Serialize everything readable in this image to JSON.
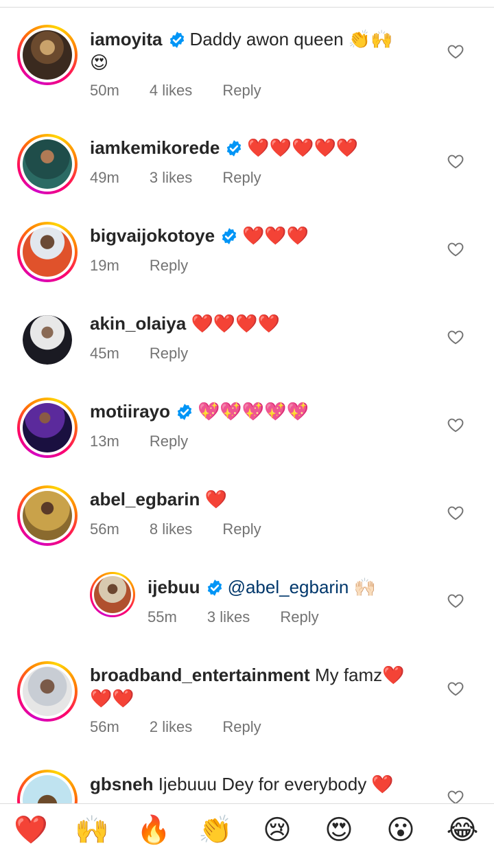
{
  "comments": [
    {
      "username": "iamoyita",
      "verified": true,
      "text": "Daddy awon queen 👏🙌",
      "text2": "😍",
      "time": "50m",
      "likes": "4 likes",
      "reply": "Reply"
    },
    {
      "username": "iamkemikorede",
      "verified": true,
      "text": "❤️❤️❤️❤️❤️",
      "time": "49m",
      "likes": "3 likes",
      "reply": "Reply"
    },
    {
      "username": "bigvaijokotoye",
      "verified": true,
      "text": "❤️❤️❤️",
      "time": "19m",
      "reply": "Reply"
    },
    {
      "username": "akin_olaiya",
      "verified": false,
      "text": "❤️❤️❤️❤️",
      "time": "45m",
      "reply": "Reply"
    },
    {
      "username": "motiirayo",
      "verified": true,
      "text": "💖💖💖💖💖",
      "time": "13m",
      "reply": "Reply"
    },
    {
      "username": "abel_egbarin",
      "verified": false,
      "text": "❤️",
      "time": "56m",
      "likes": "8 likes",
      "reply": "Reply"
    },
    {
      "username": "ijebuu",
      "verified": true,
      "mention": "@abel_egbarin",
      "text": "🙌🏻",
      "time": "55m",
      "likes": "3 likes",
      "reply": "Reply"
    },
    {
      "username": "broadband_entertainment",
      "verified": false,
      "text": "My famz❤️",
      "text2": "❤️❤️",
      "time": "56m",
      "likes": "2 likes",
      "reply": "Reply"
    },
    {
      "username": "gbsneh",
      "verified": false,
      "text": "Ijebuuu Dey for everybody ❤️"
    }
  ],
  "reactions": [
    "❤️",
    "🙌",
    "🔥",
    "👏",
    "😢",
    "😍",
    "😮",
    "😂"
  ],
  "colors": {
    "verified": "#0095f6",
    "mention": "#00376b",
    "meta": "#737373",
    "text": "#262626"
  }
}
